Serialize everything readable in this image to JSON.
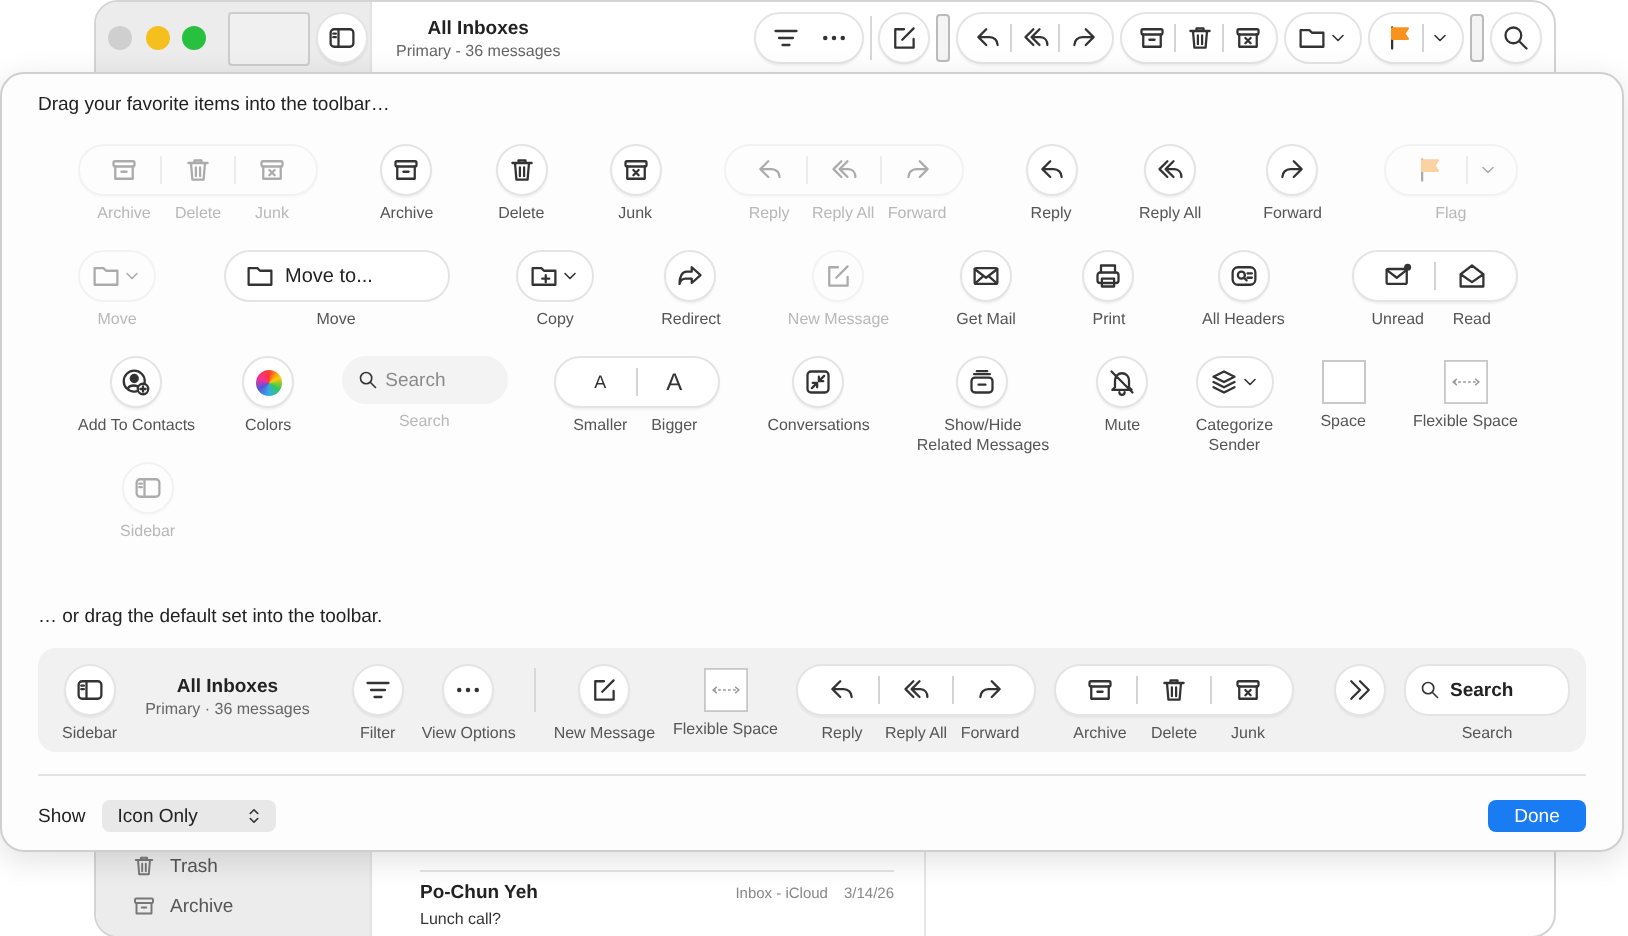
{
  "window": {
    "title": "All Inboxes",
    "subtitle": "Primary - 36 messages"
  },
  "sidebar": {
    "items": [
      {
        "label": "Trash"
      },
      {
        "label": "Archive"
      }
    ]
  },
  "messages": [
    {
      "sender": "Po-Chun Yeh",
      "mailbox": "Inbox - iCloud",
      "date": "3/14/26",
      "subject": "Lunch call?"
    }
  ],
  "sheet": {
    "palette_heading": "Drag your favorite items into the toolbar…",
    "palette_rows": [
      [
        {
          "kind": "group",
          "disabled": true,
          "buttons": [
            {
              "label": "Archive"
            },
            {
              "label": "Delete"
            },
            {
              "label": "Junk"
            }
          ]
        },
        {
          "kind": "button",
          "label": "Archive",
          "disabled": false
        },
        {
          "kind": "button",
          "label": "Delete",
          "disabled": false
        },
        {
          "kind": "button",
          "label": "Junk",
          "disabled": false
        },
        {
          "kind": "group",
          "disabled": true,
          "buttons": [
            {
              "label": "Reply"
            },
            {
              "label": "Reply All"
            },
            {
              "label": "Forward"
            }
          ]
        },
        {
          "kind": "button",
          "label": "Reply",
          "disabled": false
        },
        {
          "kind": "button",
          "label": "Reply All",
          "disabled": false
        },
        {
          "kind": "button",
          "label": "Forward",
          "disabled": false
        },
        {
          "kind": "split",
          "label": "Flag",
          "disabled": true
        }
      ],
      [
        {
          "kind": "menu",
          "label": "Move",
          "disabled": true
        },
        {
          "kind": "popup",
          "text": "Move to...",
          "label": "Move",
          "disabled": false
        },
        {
          "kind": "menu",
          "label": "Copy",
          "disabled": false
        },
        {
          "kind": "button",
          "label": "Redirect",
          "disabled": false
        },
        {
          "kind": "button",
          "label": "New Message",
          "disabled": true
        },
        {
          "kind": "button",
          "label": "Get Mail",
          "disabled": false
        },
        {
          "kind": "button",
          "label": "Print",
          "disabled": false
        },
        {
          "kind": "button",
          "label": "All Headers",
          "disabled": false
        },
        {
          "kind": "group",
          "disabled": false,
          "buttons": [
            {
              "label": "Unread"
            },
            {
              "label": "Read"
            }
          ]
        }
      ],
      [
        {
          "kind": "button",
          "label": "Add To Contacts",
          "disabled": false
        },
        {
          "kind": "button",
          "label": "Colors",
          "disabled": false
        },
        {
          "kind": "search",
          "placeholder": "Search",
          "label": "Search",
          "disabled": true
        },
        {
          "kind": "group",
          "disabled": false,
          "buttons": [
            {
              "label": "Smaller",
              "glyph": "A"
            },
            {
              "label": "Bigger",
              "glyph": "A"
            }
          ]
        },
        {
          "kind": "button",
          "label": "Conversations",
          "disabled": false
        },
        {
          "kind": "button",
          "label": "Show/Hide\nRelated Messages",
          "disabled": false
        },
        {
          "kind": "button",
          "label": "Mute",
          "disabled": false
        },
        {
          "kind": "menu",
          "label": "Categorize\nSender",
          "disabled": false
        },
        {
          "kind": "space",
          "label": "Space",
          "disabled": false
        },
        {
          "kind": "flexible",
          "label": "Flexible Space",
          "disabled": false
        }
      ],
      [
        {
          "kind": "button",
          "label": "Sidebar",
          "disabled": true
        }
      ]
    ],
    "default_heading": "… or drag the default set into the toolbar.",
    "default_set": [
      {
        "kind": "button",
        "label": "Sidebar"
      },
      {
        "kind": "title",
        "title": "All Inboxes",
        "subtitle": "Primary · 36 messages"
      },
      {
        "kind": "button",
        "label": "Filter"
      },
      {
        "kind": "button",
        "label": "View Options"
      },
      {
        "kind": "divider"
      },
      {
        "kind": "button",
        "label": "New Message"
      },
      {
        "kind": "flexible",
        "label": "Flexible Space"
      },
      {
        "kind": "group",
        "buttons": [
          {
            "label": "Reply"
          },
          {
            "label": "Reply All"
          },
          {
            "label": "Forward"
          }
        ]
      },
      {
        "kind": "group",
        "buttons": [
          {
            "label": "Archive"
          },
          {
            "label": "Delete"
          },
          {
            "label": "Junk"
          }
        ]
      },
      {
        "kind": "overflow"
      },
      {
        "kind": "search",
        "placeholder": "Search",
        "label": "Search"
      }
    ],
    "show_label": "Show",
    "show_value": "Icon Only",
    "done": "Done"
  }
}
